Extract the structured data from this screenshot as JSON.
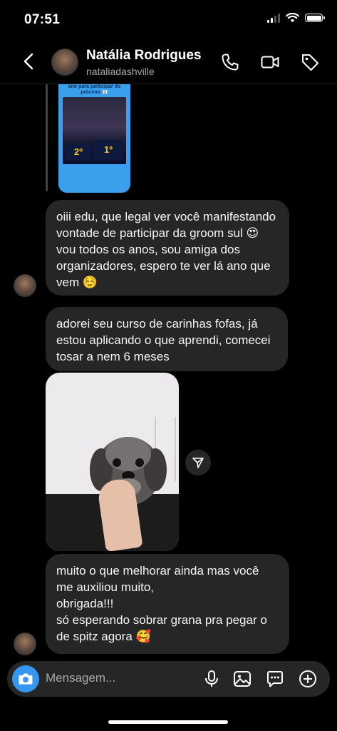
{
  "status_bar": {
    "time": "07:51"
  },
  "header": {
    "name": "Natália Rodrigues",
    "username": "nataliadashville"
  },
  "story": {
    "text": "ano para participar do próximo 👀",
    "places": [
      "2º",
      "1º"
    ]
  },
  "messages": [
    "oiii edu, que legal ver você manifestando vontade de participar da groom sul 😍 vou todos os anos, sou amiga dos organizadores, espero te ver lá ano que vem ☺️",
    "adorei seu curso de carinhas fofas, já estou aplicando o que aprendi, comecei tosar a nem 6 meses",
    "muito o que melhorar ainda mas você me auxiliou muito,\nobrigada!!!\nsó esperando sobrar grana pra pegar o de spitz agora 🥰"
  ],
  "composer": {
    "placeholder": "Mensagem..."
  },
  "colors": {
    "accent": "#3797f0",
    "bubble": "#262626",
    "background": "#000000"
  }
}
